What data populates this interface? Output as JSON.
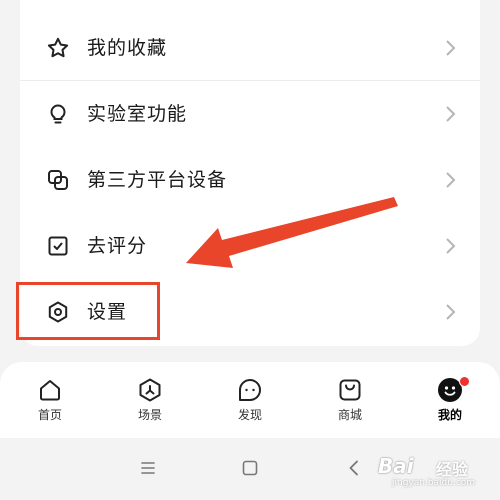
{
  "menu": {
    "items": [
      {
        "label": "我的收藏",
        "icon": "star-icon"
      },
      {
        "label": "实验室功能",
        "icon": "lightbulb-icon"
      },
      {
        "label": "第三方平台设备",
        "icon": "linked-squares-icon"
      },
      {
        "label": "去评分",
        "icon": "checkbox-icon"
      },
      {
        "label": "设置",
        "icon": "settings-hexagon-icon"
      }
    ]
  },
  "annotation": {
    "highlight_color": "#e8452a",
    "highlighted_item": "设置"
  },
  "tabbar": {
    "tabs": [
      {
        "label": "首页",
        "icon": "home-icon",
        "active": false
      },
      {
        "label": "场景",
        "icon": "scene-icon",
        "active": false
      },
      {
        "label": "发现",
        "icon": "discover-icon",
        "active": false
      },
      {
        "label": "商城",
        "icon": "shop-icon",
        "active": false
      },
      {
        "label": "我的",
        "icon": "profile-icon",
        "active": true
      }
    ],
    "badge_color": "#f0312d"
  },
  "system_nav": {
    "buttons": [
      "menu-icon",
      "home-square-icon",
      "back-icon"
    ]
  },
  "watermark": {
    "brand": "Bai",
    "sub": "经验",
    "url": "jingyan.baidu.com"
  }
}
